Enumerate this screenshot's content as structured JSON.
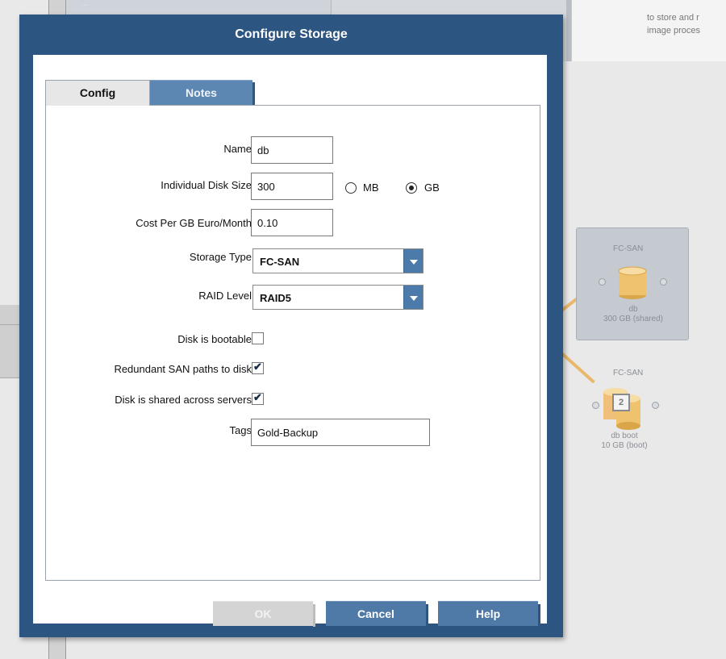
{
  "background": {
    "top_right_text_line1": "to store and r",
    "top_right_text_line2": "image proces",
    "top_label": "...",
    "storage_node_1": {
      "type": "FC-SAN",
      "name": "db",
      "size": "300 GB (shared)"
    },
    "storage_node_2": {
      "type": "FC-SAN",
      "count": "2",
      "name": "db boot",
      "size": "10 GB (boot)"
    }
  },
  "dialog": {
    "title": "Configure Storage",
    "tabs": [
      {
        "label": "Config",
        "active": true
      },
      {
        "label": "Notes",
        "active": false
      }
    ],
    "form": {
      "name": {
        "label": "Name",
        "value": "db"
      },
      "disk_size": {
        "label": "Individual Disk Size",
        "value": "300",
        "unit_options": [
          "MB",
          "GB"
        ],
        "selected_unit": "GB"
      },
      "cost": {
        "label": "Cost Per GB Euro/Month",
        "value": "0.10"
      },
      "storage_type": {
        "label": "Storage Type",
        "value": "FC-SAN"
      },
      "raid_level": {
        "label": "RAID Level",
        "value": "RAID5"
      },
      "bootable": {
        "label": "Disk is bootable",
        "checked": false
      },
      "redundant_paths": {
        "label": "Redundant SAN paths to disk",
        "checked": true
      },
      "shared": {
        "label": "Disk is shared across servers",
        "checked": true
      },
      "tags": {
        "label": "Tags",
        "value": "Gold-Backup"
      }
    },
    "buttons": {
      "ok": "OK",
      "cancel": "Cancel",
      "help": "Help"
    },
    "check_glyph": "✔"
  }
}
